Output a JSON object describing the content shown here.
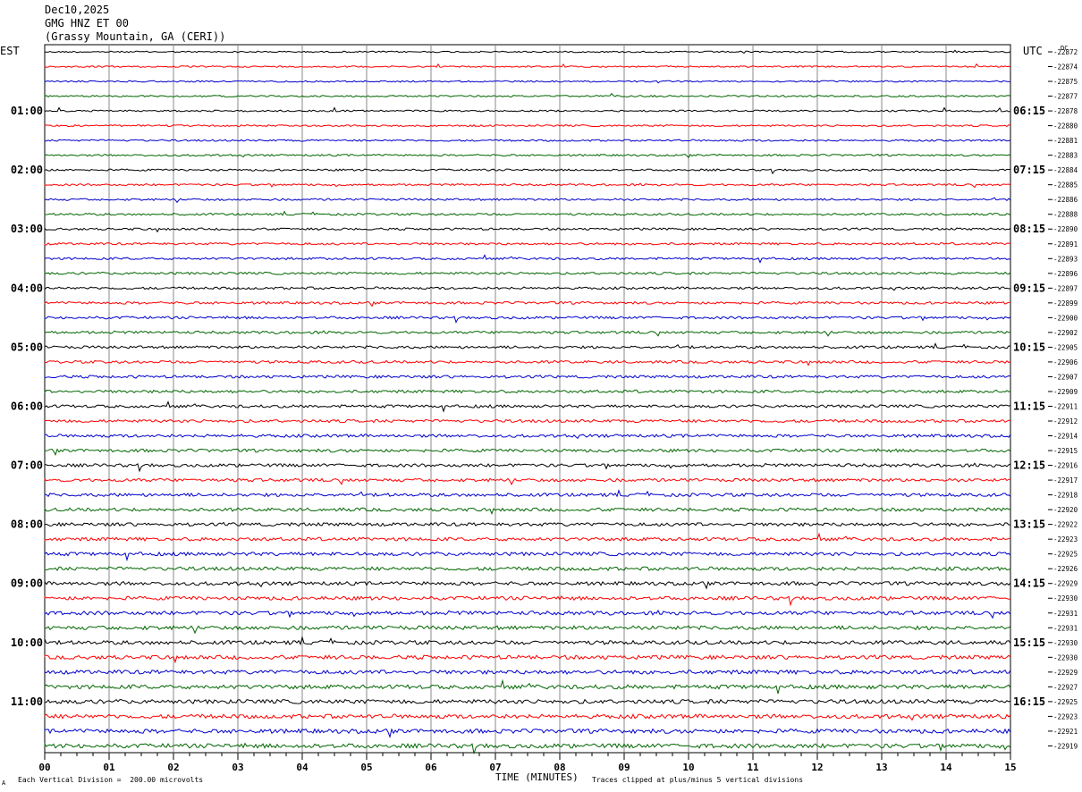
{
  "header": {
    "date": "Dec10,2025",
    "station": "GMG HNZ ET 00",
    "location": "(Grassy Mountain, GA (CERI))"
  },
  "left_tz": "EST",
  "right_tz": "UTC",
  "dc_label": "DC",
  "footer": {
    "scale_note": "Each Vertical Division =  200.00 microvolts",
    "clip_note": "Traces clipped at plus/minus 5 vertical divisions",
    "mark": "A"
  },
  "colors": [
    "#000000",
    "#ff0000",
    "#0000cc",
    "#006600"
  ],
  "chart_data": {
    "type": "line",
    "title": "",
    "xlabel": "TIME (MINUTES)",
    "xlim": [
      0,
      15
    ],
    "x_ticks": [
      "00",
      "01",
      "02",
      "03",
      "04",
      "05",
      "06",
      "07",
      "08",
      "09",
      "10",
      "11",
      "12",
      "13",
      "14",
      "15"
    ],
    "left_hour_labels": [
      "01:00",
      "02:00",
      "03:00",
      "04:00",
      "05:00",
      "06:00",
      "07:00",
      "08:00",
      "09:00",
      "10:00",
      "11:00"
    ],
    "right_hour_labels": [
      "06:15",
      "07:15",
      "08:15",
      "09:15",
      "10:15",
      "11:15",
      "12:15",
      "13:15",
      "14:15",
      "15:15",
      "16:15"
    ],
    "trace_dc_values": [
      "-22872",
      "-22874",
      "-22875",
      "-22877",
      "-22878",
      "-22880",
      "-22881",
      "-22883",
      "-22884",
      "-22885",
      "-22886",
      "-22888",
      "-22890",
      "-22891",
      "-22893",
      "-22896",
      "-22897",
      "-22899",
      "-22900",
      "-22902",
      "-22905",
      "-22906",
      "-22907",
      "-22909",
      "-22911",
      "-22912",
      "-22914",
      "-22915",
      "-22916",
      "-22917",
      "-22918",
      "-22920",
      "-22922",
      "-22923",
      "-22925",
      "-22926",
      "-22929",
      "-22930",
      "-22931",
      "-22931",
      "-22930",
      "-22930",
      "-22929",
      "-22927",
      "-22925",
      "-22923",
      "-22921",
      "-22919"
    ],
    "trace_count": 48,
    "trace_interval_minutes": 15
  }
}
